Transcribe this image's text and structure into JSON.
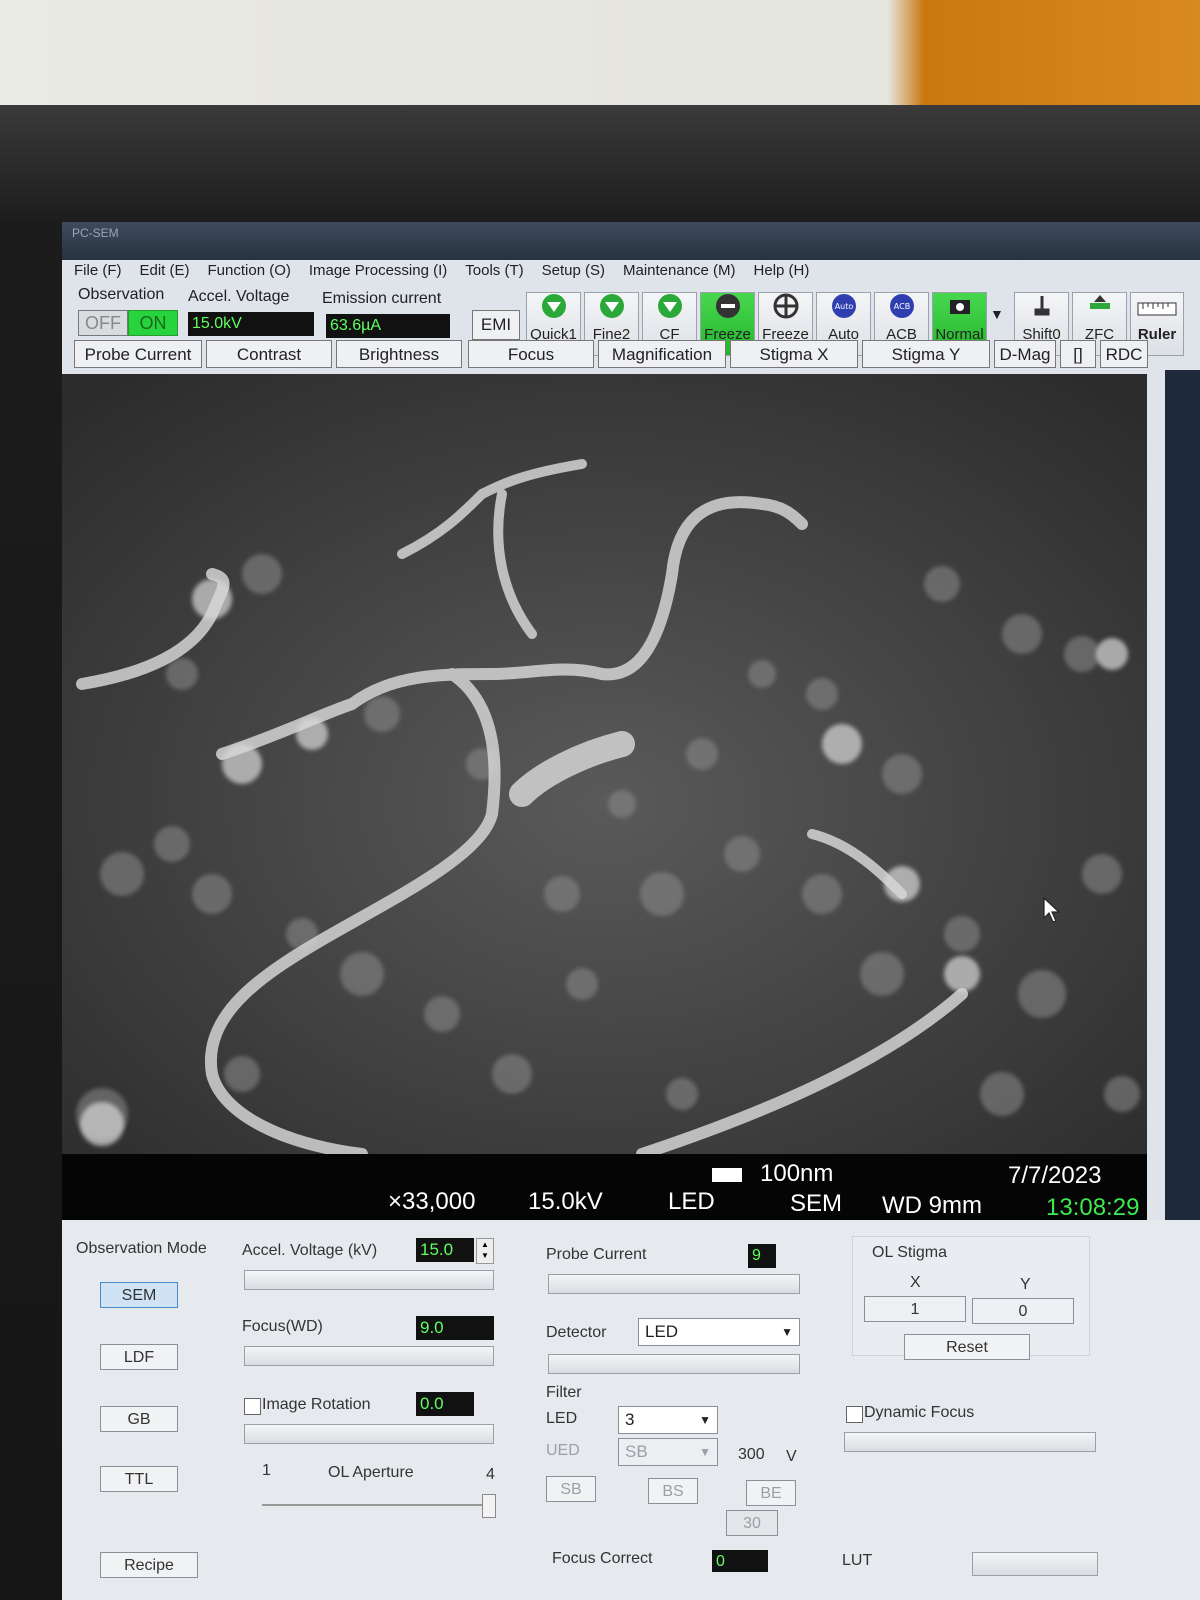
{
  "window": {
    "title": "PC-SEM"
  },
  "menu": [
    "File (F)",
    "Edit (E)",
    "Function (O)",
    "Image Processing (I)",
    "Tools (T)",
    "Setup (S)",
    "Maintenance (M)",
    "Help (H)"
  ],
  "toolbar": {
    "observation_label": "Observation",
    "off_label": "OFF",
    "on_label": "ON",
    "accel_label": "Accel. Voltage",
    "accel_value": "15.0kV",
    "emission_label": "Emission current",
    "emission_value": "63.6µA",
    "emi_label": "EMI",
    "buttons": [
      {
        "label": "Quick1",
        "icon": "down-arrow-icon"
      },
      {
        "label": "Fine2",
        "icon": "down-arrow-icon"
      },
      {
        "label": "CF",
        "icon": "down-arrow-icon"
      },
      {
        "label": "Freeze",
        "icon": "minus-circle-icon"
      },
      {
        "label": "Freeze",
        "icon": "crosshair-icon"
      },
      {
        "label": "Auto",
        "icon": "auto-icon"
      },
      {
        "label": "ACB",
        "icon": "acb-icon"
      },
      {
        "label": "Normal",
        "icon": "camera-icon"
      },
      {
        "label": "Shift0",
        "icon": "stage-icon"
      },
      {
        "label": "ZFC",
        "icon": "zfc-icon"
      },
      {
        "label": "Ruler",
        "icon": "ruler-icon"
      }
    ]
  },
  "tabs": [
    "Probe Current",
    "Contrast",
    "Brightness",
    "Focus",
    "Magnification",
    "Stigma X",
    "Stigma Y",
    "D-Mag",
    "[]",
    "RDC"
  ],
  "image_info": {
    "magnification": "×33,000",
    "voltage": "15.0kV",
    "detector": "LED",
    "scale": "100nm",
    "mode": "SEM",
    "wd": "WD  9mm",
    "date": "7/7/2023",
    "time": "13:08:29"
  },
  "panel": {
    "observation_mode": "Observation Mode",
    "modes": [
      "SEM",
      "LDF",
      "GB",
      "TTL"
    ],
    "recipe": "Recipe",
    "accel_label": "Accel. Voltage (kV)",
    "accel_value": "15.0",
    "focus_label": "Focus(WD)",
    "focus_value": "9.0",
    "rotation_label": "Image Rotation",
    "rotation_value": "0.0",
    "aperture_min": "1",
    "aperture_label": "OL Aperture",
    "aperture_max": "4",
    "probe_label": "Probe Current",
    "probe_value": "9",
    "detector_label": "Detector",
    "detector_value": "LED",
    "filter_label": "Filter",
    "led_label": "LED",
    "led_value": "3",
    "ued_label": "UED",
    "ued_value": "SB",
    "voltage_value": "300",
    "voltage_unit": "V",
    "sb": "SB",
    "bs": "BS",
    "be": "BE",
    "be_value": "30",
    "focus_correct": "Focus Correct",
    "focus_correct_value": "0",
    "stigma_label": "OL Stigma",
    "stigma_x": "X",
    "stigma_y": "Y",
    "stigma_x_value": "1",
    "stigma_y_value": "0",
    "reset": "Reset",
    "dynamic_focus": "Dynamic Focus",
    "lut": "LUT"
  }
}
